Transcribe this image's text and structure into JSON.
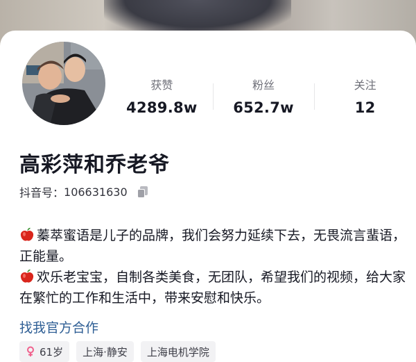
{
  "cover": {
    "description_icon": "cover-photo"
  },
  "profile": {
    "name": "高彩萍和乔老爷",
    "id_label": "抖音号：",
    "id_value": "106631630",
    "copy_icon": "copy-icon"
  },
  "stats": [
    {
      "label": "获赞",
      "value": "4289.8w"
    },
    {
      "label": "粉丝",
      "value": "652.7w"
    },
    {
      "label": "关注",
      "value": "12"
    }
  ],
  "bio": {
    "line1": "蓁萃蜜语是儿子的品牌，我们会努力延续下去，无畏流言蜚语，正能量。",
    "line2": "欢乐老宝宝，自制各类美食，无团队，希望我们的视频，给大家在繁忙的工作和生活中，带来安慰和快乐。",
    "bullet_icon": "red-apple-icon"
  },
  "link_text": "找我官方合作",
  "tags": {
    "age": "61岁",
    "age_icon": "female-icon",
    "location": "上海·静安",
    "school": "上海电机学院"
  },
  "colors": {
    "link": "#2f5f95",
    "female_icon": "#f0608c",
    "apple": "#d9261c"
  }
}
